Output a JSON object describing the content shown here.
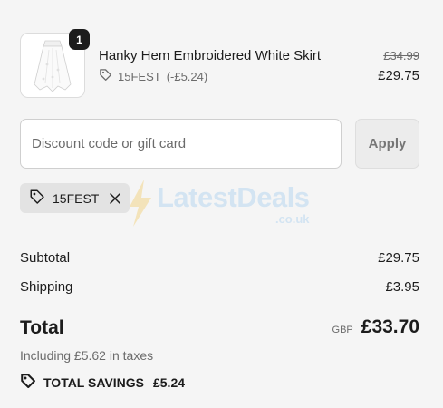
{
  "product": {
    "quantity": "1",
    "title": "Hanky Hem Embroidered White Skirt",
    "discount_code": "15FEST",
    "discount_amount": "(-£5.24)",
    "compare_price": "£34.99",
    "price": "£29.75"
  },
  "discount": {
    "placeholder": "Discount code or gift card",
    "apply_label": "Apply",
    "applied_code": "15FEST"
  },
  "watermark": {
    "brand": "LatestDeals",
    "domain": ".co.uk"
  },
  "summary": {
    "subtotal_label": "Subtotal",
    "subtotal_value": "£29.75",
    "shipping_label": "Shipping",
    "shipping_value": "£3.95",
    "total_label": "Total",
    "currency": "GBP",
    "total_value": "£33.70",
    "taxes_text": "Including £5.62 in taxes",
    "savings_label": "TOTAL SAVINGS",
    "savings_value": "£5.24"
  },
  "colors": {
    "background": "#f5f5f5",
    "text": "#1c1c1c",
    "muted": "#6b6b6b",
    "tag_background": "#e3e3e3"
  }
}
